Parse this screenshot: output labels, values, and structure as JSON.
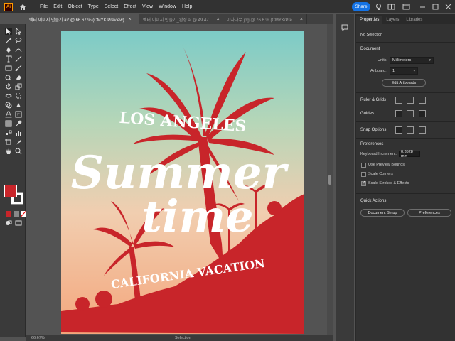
{
  "app": {
    "logo": "Ai",
    "share": "Share"
  },
  "menu": [
    "File",
    "Edit",
    "Object",
    "Type",
    "Select",
    "Effect",
    "View",
    "Window",
    "Help"
  ],
  "tabs": [
    {
      "label": "벡터 이미지 만들기.ai* @ 66.67 % (CMYK/Preview)",
      "active": true
    },
    {
      "label": "벡터 이미지 만들기_완성.ai @ 49.47...",
      "active": false
    },
    {
      "label": "야자나무.jpg @ 76.6 % (CMYK/Pre...",
      "active": false
    }
  ],
  "tab_close": "×",
  "artwork": {
    "line1": "LOS ANGELES",
    "line2": "Summer",
    "line3": "time",
    "line4": "CALIFORNIA VACATION"
  },
  "status": {
    "zoom": "66.67%",
    "mode": "Selection"
  },
  "panel": {
    "tabs": [
      "Properties",
      "Layers",
      "Libraries"
    ],
    "no_selection": "No Selection",
    "document": "Document",
    "units_label": "Units:",
    "units_value": "Millimeters",
    "artboard_label": "Artboard:",
    "artboard_value": "1",
    "edit_artboards": "Edit Artboards",
    "rulers_grids": "Ruler & Grids",
    "guides": "Guides",
    "snap_options": "Snap Options",
    "preferences": "Preferences",
    "keyboard_increment_label": "Keyboard Increment:",
    "keyboard_increment_value": "0.3528 mm",
    "use_preview_bounds": "Use Preview Bounds",
    "scale_corners": "Scale Corners",
    "scale_strokes": "Scale Strokes & Effects",
    "quick_actions": "Quick Actions",
    "document_setup": "Document Setup",
    "preferences_btn": "Preferences"
  },
  "colors": {
    "accent": "#1473e6",
    "artwork_red": "#c8252a"
  }
}
